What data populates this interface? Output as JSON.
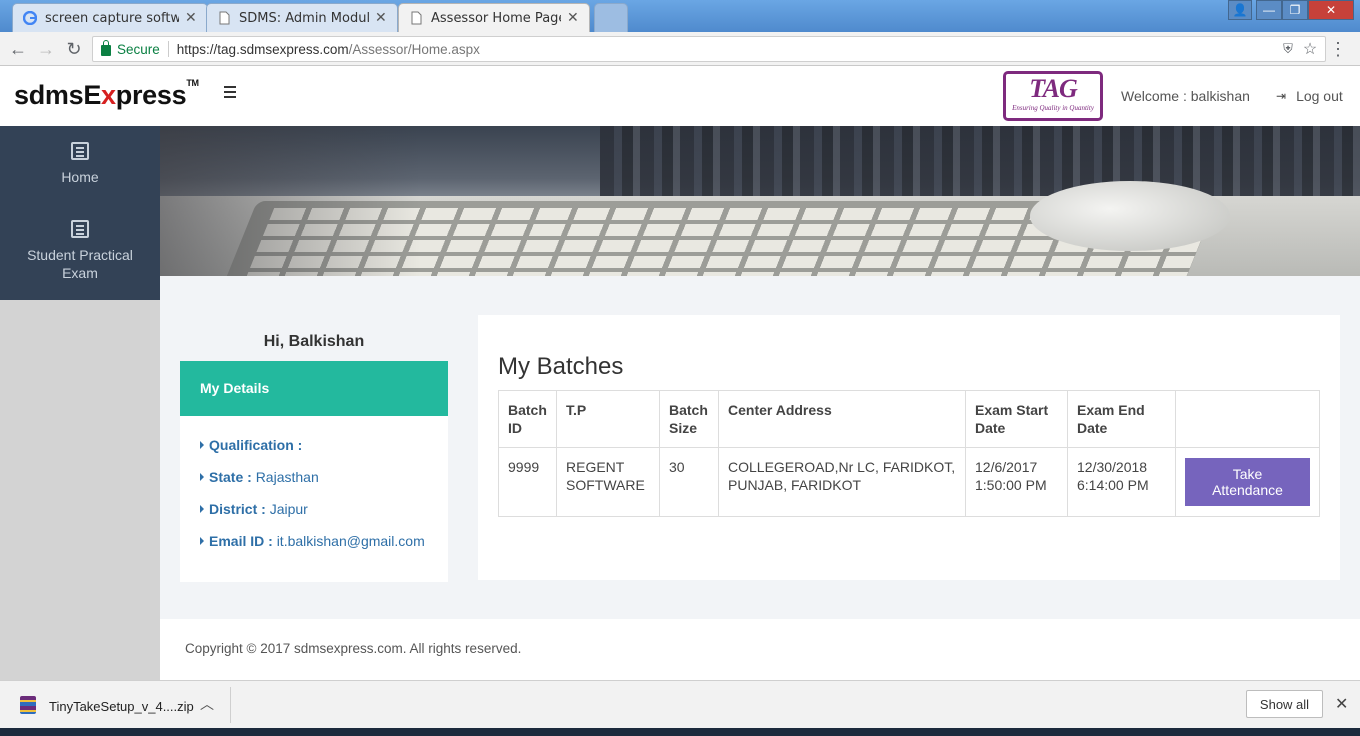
{
  "browser": {
    "tabs": [
      {
        "title": "screen capture software"
      },
      {
        "title": "SDMS: Admin Module"
      },
      {
        "title": "Assessor Home Page"
      }
    ],
    "secure_label": "Secure",
    "url_host": "https://tag.sdmsexpress.com",
    "url_path": "/Assessor/Home.aspx"
  },
  "header": {
    "brand_a": "sdmsE",
    "brand_x": "x",
    "brand_b": "press",
    "brand_tm": "TM",
    "tag_logo": "TAG",
    "tag_tagline": "Ensuring Quality in Quantity",
    "welcome": "Welcome : balkishan",
    "logout": "Log out"
  },
  "sidebar": {
    "items": [
      {
        "label": "Home",
        "icon": "list-icon"
      },
      {
        "label": "Student Practical Exam",
        "icon": "list-icon"
      }
    ]
  },
  "profile": {
    "greeting": "Hi, Balkishan",
    "panel_title": "My Details",
    "fields": [
      {
        "label": "Qualification :",
        "value": ""
      },
      {
        "label": "State :",
        "value": "Rajasthan"
      },
      {
        "label": "District :",
        "value": "Jaipur"
      },
      {
        "label": "Email ID :",
        "value": "it.balkishan@gmail.com"
      }
    ]
  },
  "batches": {
    "title": "My Batches",
    "columns": [
      "Batch ID",
      "T.P",
      "Batch Size",
      "Center Address",
      "Exam Start Date",
      "Exam End Date",
      ""
    ],
    "rows": [
      {
        "batch_id": "9999",
        "tp": "REGENT SOFTWARE",
        "batch_size": "30",
        "center_address": "COLLEGEROAD,Nr LC, FARIDKOT, PUNJAB, FARIDKOT",
        "start_date": "12/6/2017 1:50:00 PM",
        "end_date": "12/30/2018 6:14:00 PM",
        "action": "Take Attendance"
      }
    ]
  },
  "footer": {
    "copyright": "Copyright © 2017 sdmsexpress.com. All rights reserved."
  },
  "downloads": {
    "file": "TinyTakeSetup_v_4....zip",
    "show_all": "Show all"
  },
  "colors": {
    "teal": "#23b99e",
    "sidebar": "#334256",
    "button": "#7664bd",
    "link": "#2e6fa7"
  }
}
